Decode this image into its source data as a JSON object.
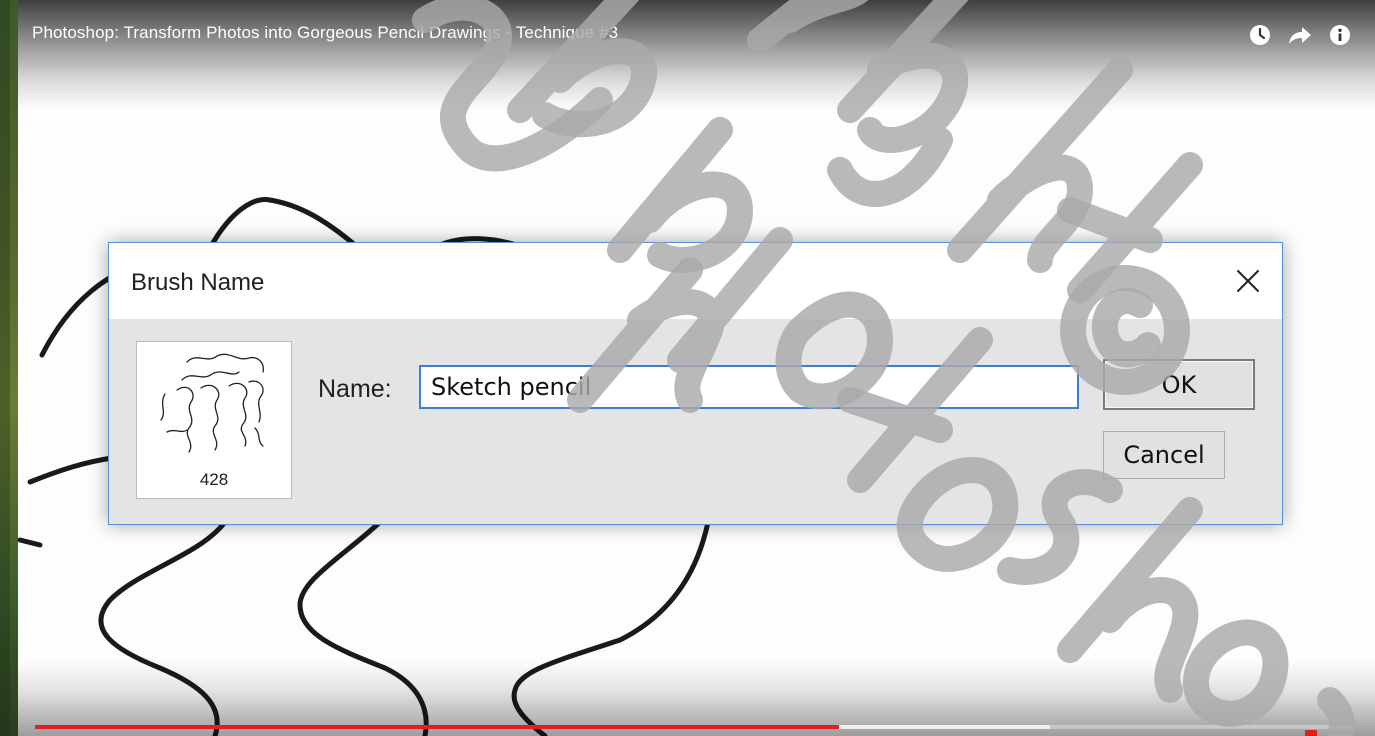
{
  "video": {
    "title": "Photoshop: Transform Photos into Gorgeous Pencil Drawings - Technique #3",
    "icons": [
      "watch-later-icon",
      "share-icon",
      "info-icon"
    ],
    "progress": {
      "played_fraction": 0.61,
      "buffered_fraction": 0.77,
      "played_color": "#e02020"
    }
  },
  "dialog": {
    "title": "Brush Name",
    "brush_size": "428",
    "name_label": "Name:",
    "name_value": "Sketch pencil",
    "ok_label": "OK",
    "cancel_label": "Cancel",
    "accent_color": "#3c7fd0"
  },
  "watermark": {
    "text": "Deep photoshop copyright©",
    "color": "#b0b0b0"
  }
}
